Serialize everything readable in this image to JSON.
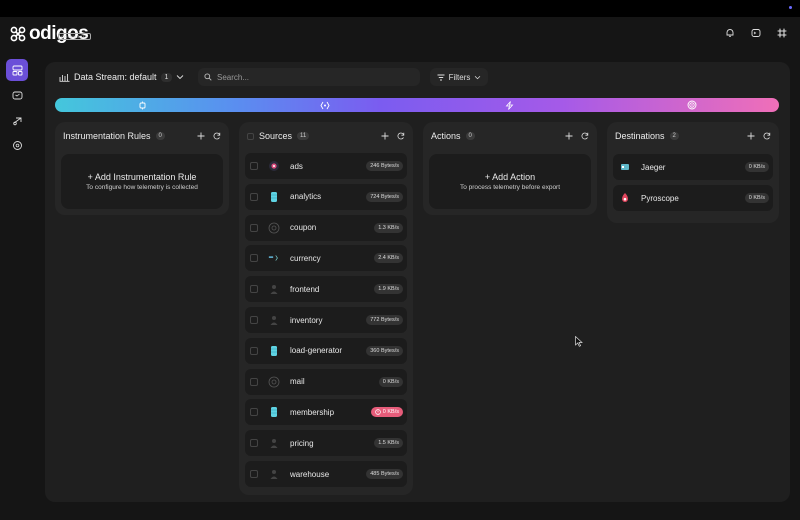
{
  "brand": {
    "name": "odigos",
    "edition": "COMMUNITY"
  },
  "header_icons": [
    "bell-icon",
    "terminal-icon",
    "slack-icon"
  ],
  "sidenav": [
    "overview-icon",
    "sources-icon",
    "destinations-icon",
    "actions-icon"
  ],
  "toolbar": {
    "stream_label": "Data Stream: default",
    "stream_count": "1",
    "search_placeholder": "Search...",
    "filters_label": "Filters"
  },
  "columns": {
    "rules": {
      "title": "Instrumentation Rules",
      "count": "0",
      "empty_title": "Add Instrumentation Rule",
      "empty_sub": "To configure how telemetry is collected"
    },
    "sources": {
      "title": "Sources",
      "count": "11",
      "items": [
        {
          "name": "ads",
          "rate": "246 Bytes/s",
          "icon": "ads-icon",
          "error": false
        },
        {
          "name": "analytics",
          "rate": "724 Bytes/s",
          "icon": "database-icon",
          "error": false
        },
        {
          "name": "coupon",
          "rate": "1.3 KB/s",
          "icon": "service-icon",
          "error": false
        },
        {
          "name": "currency",
          "rate": "2.4 KB/s",
          "icon": "currency-icon",
          "error": false
        },
        {
          "name": "frontend",
          "rate": "1.9 KB/s",
          "icon": "user-icon",
          "error": false
        },
        {
          "name": "inventory",
          "rate": "772 Bytes/s",
          "icon": "user-icon",
          "error": false
        },
        {
          "name": "load-generator",
          "rate": "360 Bytes/s",
          "icon": "database-icon",
          "error": false
        },
        {
          "name": "mail",
          "rate": "0 KB/s",
          "icon": "service-icon",
          "error": false
        },
        {
          "name": "membership",
          "rate": "0 KB/s",
          "icon": "database-icon",
          "error": true
        },
        {
          "name": "pricing",
          "rate": "1.5 KB/s",
          "icon": "user-icon",
          "error": false
        },
        {
          "name": "warehouse",
          "rate": "485 Bytes/s",
          "icon": "user-icon",
          "error": false
        }
      ]
    },
    "actions": {
      "title": "Actions",
      "count": "0",
      "empty_title": "Add Action",
      "empty_sub": "To process telemetry before export"
    },
    "destinations": {
      "title": "Destinations",
      "count": "2",
      "items": [
        {
          "name": "Jaeger",
          "rate": "0 KB/s",
          "icon": "jaeger-icon"
        },
        {
          "name": "Pyroscope",
          "rate": "0 KB/s",
          "icon": "pyroscope-icon"
        }
      ]
    }
  },
  "colors": {
    "accent": "#6b4fd8",
    "error": "#e65c7a",
    "panel": "#262626"
  }
}
